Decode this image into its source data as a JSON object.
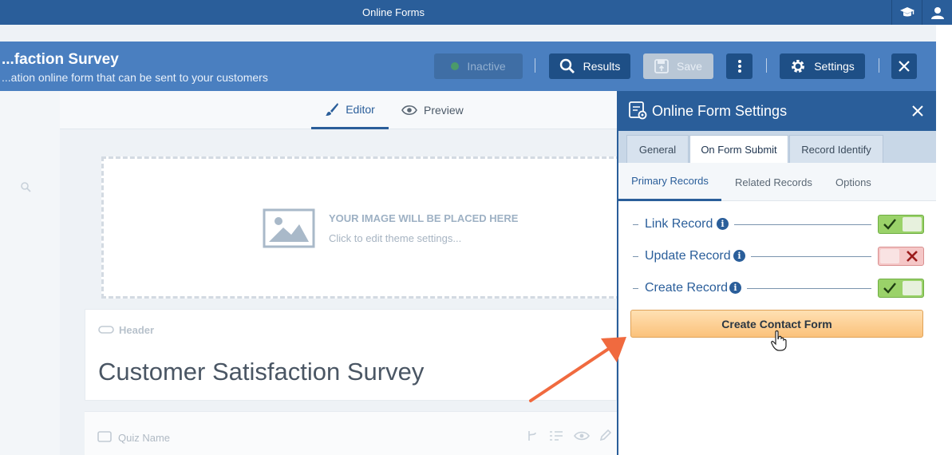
{
  "app": {
    "title": "Online Forms"
  },
  "form": {
    "name": "...faction Survey",
    "description": "...ation online form that can be sent to your customers"
  },
  "toolbar": {
    "inactive_label": "Inactive",
    "results_label": "Results",
    "save_label": "Save",
    "settings_label": "Settings"
  },
  "editor_tabs": [
    {
      "label": "Editor"
    },
    {
      "label": "Preview"
    }
  ],
  "canvas": {
    "image_placeholder_title": "YOUR IMAGE WILL BE PLACED HERE",
    "image_placeholder_hint": "Click to edit theme settings...",
    "header_block_label": "Header",
    "survey_title": "Customer Satisfaction Survey",
    "next_block_label": "Quiz Name"
  },
  "settings_panel": {
    "title": "Online Form Settings",
    "tabs": [
      {
        "label": "General"
      },
      {
        "label": "On Form Submit"
      },
      {
        "label": "Record Identify"
      }
    ],
    "active_tab": "On Form Submit",
    "subtabs": [
      {
        "label": "Primary Records"
      },
      {
        "label": "Related Records"
      },
      {
        "label": "Options"
      }
    ],
    "active_subtab": "Primary Records",
    "records": [
      {
        "label": "Link Record",
        "enabled": true
      },
      {
        "label": "Update Record",
        "enabled": false
      },
      {
        "label": "Create Record",
        "enabled": true
      }
    ],
    "create_button_label": "Create Contact Form"
  },
  "colors": {
    "primary": "#2a5e9a",
    "toggle_on": "#9ad269",
    "toggle_off": "#f5c7c7",
    "cta": "#fbc27b",
    "arrow": "#f06a3f"
  }
}
